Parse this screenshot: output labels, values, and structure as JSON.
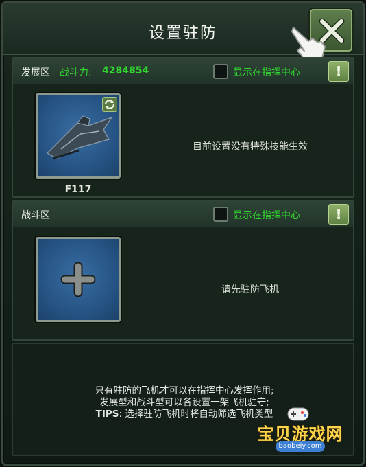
{
  "dialog": {
    "title": "设置驻防"
  },
  "development_zone": {
    "label": "发展区",
    "power_label": "战斗力:",
    "power_value": "4284854",
    "show_in_center_label": "显示在指挥中心",
    "show_in_center_checked": false,
    "info_icon": "exclamation-icon",
    "plane_name": "F117",
    "effect_text": "目前设置没有特殊技能生效"
  },
  "combat_zone": {
    "label": "战斗区",
    "show_in_center_label": "显示在指挥中心",
    "show_in_center_checked": false,
    "info_icon": "exclamation-icon",
    "need_text": "请先驻防飞机"
  },
  "tips": {
    "line1": "只有驻防的飞机才可以在指挥中心发挥作用;",
    "line2": "发展型和战斗型可以各设置一架飞机驻守;",
    "line3_key": "TIPS",
    "line3_text": ": 选择驻防飞机时将自动筛选飞机类型"
  },
  "watermark": {
    "text": "宝贝游戏网",
    "url": "baobeiy.com"
  },
  "colors": {
    "accent_green": "#31d82f",
    "button_green": "#5f8243"
  }
}
